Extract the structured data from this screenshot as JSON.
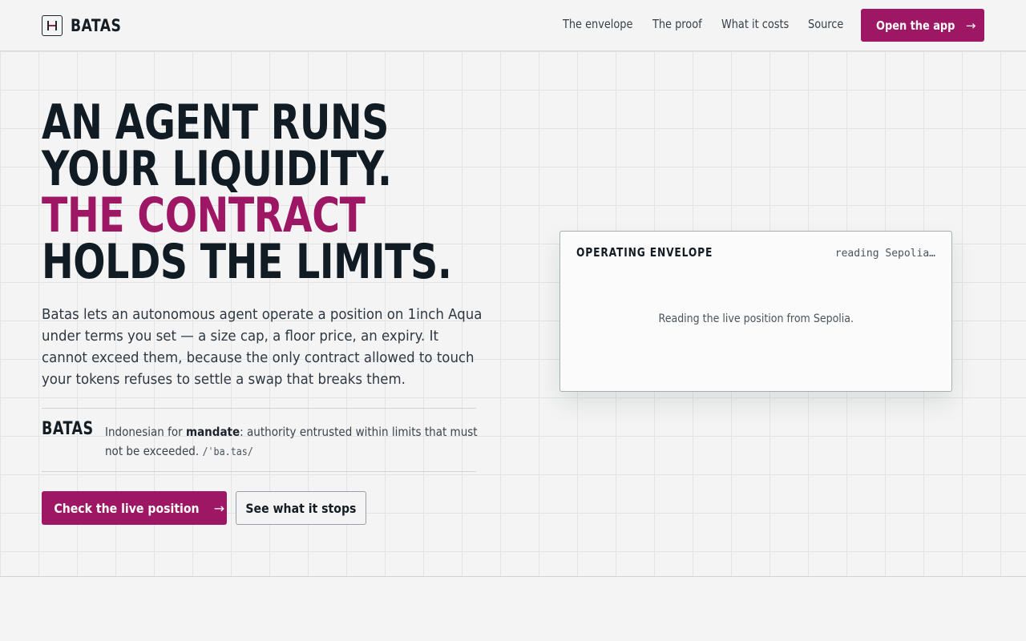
{
  "header": {
    "brand": "BATAS",
    "nav": [
      "The envelope",
      "The proof",
      "What it costs",
      "Source"
    ],
    "cta_label": "Open the app",
    "cta_arrow": "→"
  },
  "hero": {
    "headline": [
      "AN AGENT RUNS",
      "YOUR LIQUIDITY.",
      "THE CONTRACT",
      "HOLDS THE LIMITS."
    ],
    "lede": "Batas lets an autonomous agent operate a position on 1inch Aqua under terms you set — a size cap, a floor price, an expiry. It cannot exceed them, because the only contract allowed to touch your tokens refuses to settle a swap that breaks them.",
    "definition": {
      "word": "BATAS",
      "prefix": "Indonesian for ",
      "term": "mandate",
      "meaning": ": authority entrusted within limits that must not be exceeded.",
      "pronunciation": "/ˈba.tas/"
    },
    "primary_button": "Check the live position",
    "primary_arrow": "→",
    "secondary_button": "See what it stops"
  },
  "envelope_card": {
    "title": "OPERATING ENVELOPE",
    "status": "reading Sepolia…",
    "message": "Reading the live position from Sepolia."
  },
  "colors": {
    "accent": "#9e1765",
    "ink": "#111b23",
    "background": "#f3f4f3"
  },
  "icons": {
    "brand_mark": "brand-logo-icon",
    "arrow": "arrow-right-icon"
  }
}
